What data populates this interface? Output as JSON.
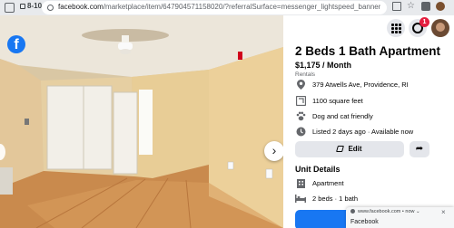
{
  "browser": {
    "tab_count": "8-10",
    "url_host": "facebook.com",
    "url_path": "/marketplace/item/647904571158020/?referralSurface=messenger_lightspeed_banner&referralCode=messenger_..."
  },
  "icons": {
    "facebook_logo": "f",
    "next_arrow": "›",
    "share": "➦",
    "close": "×"
  },
  "listing": {
    "title": "2 Beds 1 Bath Apartment",
    "price": "$1,175 / Month",
    "category": "Rentals",
    "details": [
      {
        "icon": "location-pin-icon",
        "text": "379 Atwells Ave, Providence, RI"
      },
      {
        "icon": "ruler-icon",
        "text": "1100 square feet"
      },
      {
        "icon": "paw-icon",
        "text": "Dog and cat friendly"
      },
      {
        "icon": "clock-icon",
        "text": "Listed 2 days ago · Available now"
      }
    ],
    "edit_label": "Edit",
    "unit_details_title": "Unit Details",
    "unit_details": [
      {
        "icon": "building-icon",
        "text": "Apartment"
      },
      {
        "icon": "bed-icon",
        "text": "2 beds · 1 bath"
      }
    ],
    "message_button_fragment": "M"
  },
  "topbar": {
    "notification_count": "1"
  },
  "notification": {
    "source": "www.facebook.com",
    "time": "now",
    "separator": "•",
    "chevron": "⌄",
    "label": "Facebook"
  },
  "colors": {
    "accent": "#1877f2",
    "badge": "#e41e3f",
    "button_bg": "#e4e6eb"
  }
}
